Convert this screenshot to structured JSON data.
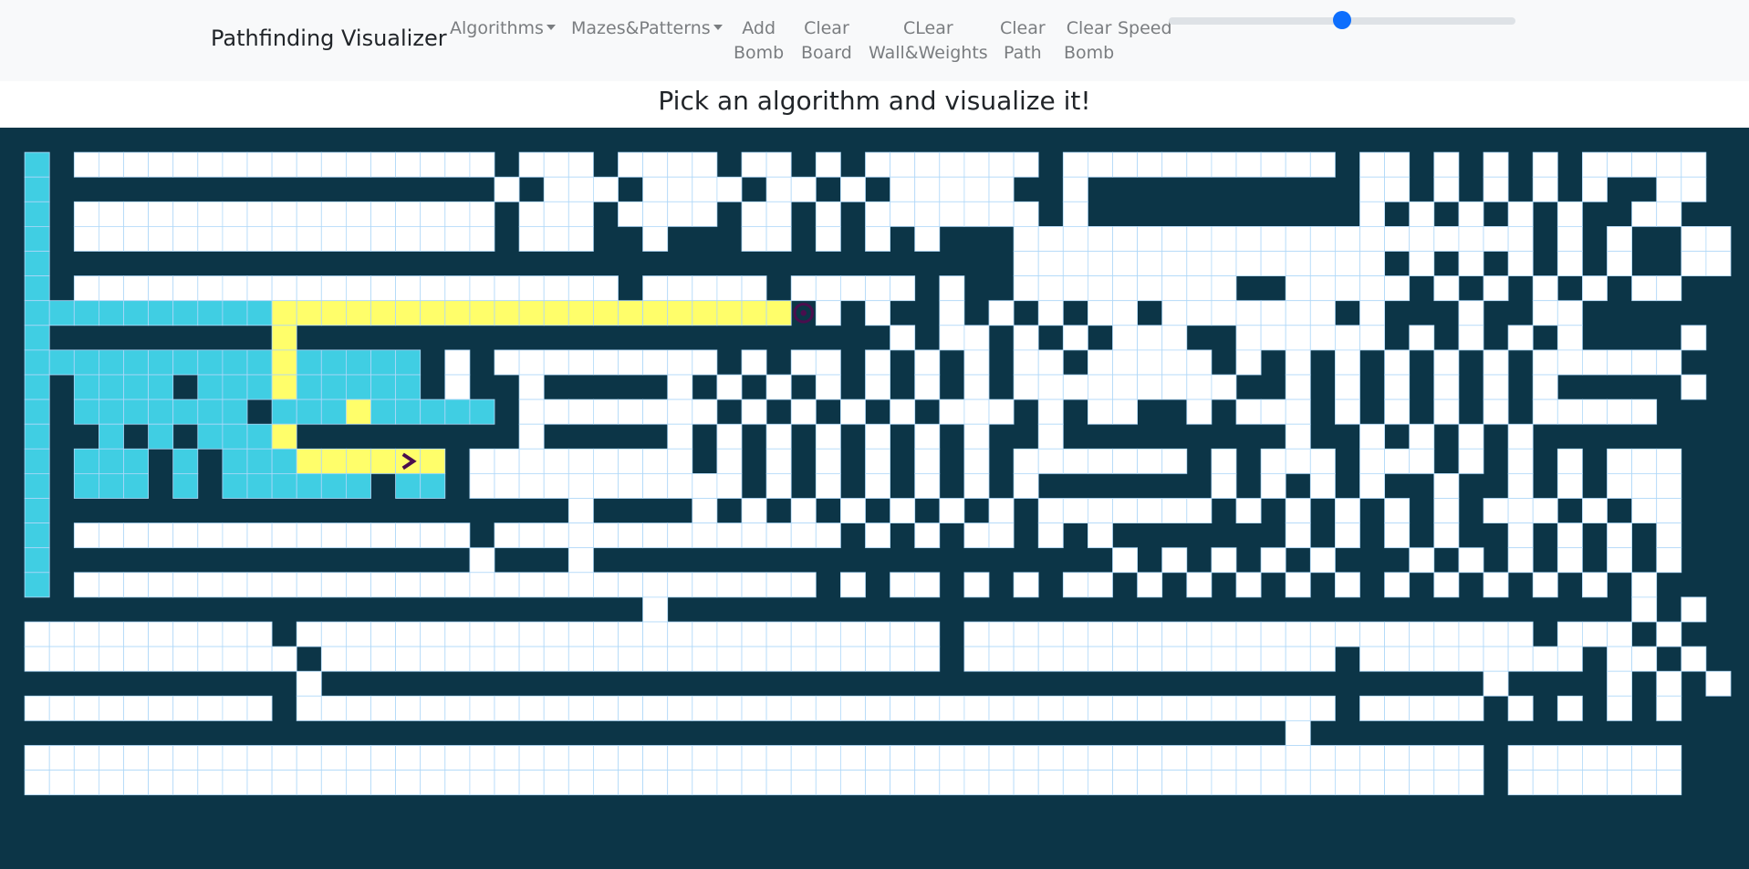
{
  "navbar": {
    "brand": "Pathfinding Visualizer",
    "algorithms": "Algorithms",
    "mazes": "Mazes&Patterns",
    "add_bomb": [
      "Add",
      "Bomb"
    ],
    "clear_board": [
      "Clear",
      "Board"
    ],
    "clear_walls": [
      "CLear",
      "Wall&Weights"
    ],
    "clear_path": [
      "Clear",
      "Path"
    ],
    "clear_bomb": [
      "Clear",
      "Bomb"
    ],
    "speed_label": "Speed",
    "speed_value": 0.5
  },
  "subtitle": "Pick an algorithm and visualize it!",
  "colors": {
    "wall": "#0c3547",
    "open": "#ffffff",
    "gridline": "#afd8f8",
    "visited": "#40cee3",
    "path": "#fffe6a",
    "marker": "#4a0e4e",
    "slider": "#0d6efd"
  },
  "icons": {
    "start": "chevron-right-icon",
    "target": "bullseye-icon"
  },
  "grid": {
    "rows": 28,
    "cols": 70,
    "start": [
      13,
      16
    ],
    "target": [
      7,
      32
    ],
    "cells": [
      "######################################################################",
      "#V#.................#...#....#..#.#.......#...........#..#.#.#.#.....#",
      "#V##################.#...#....#..#.#.....##.###########..#.#.#.#.##..#",
      "#V#.................#...#....#..#.#.......#.###########.#.#.#.#.##..#",
      "#V#.................#...##.###..#.#.#.###.....................#.#.##..#",
      "#V#######################################...............#.#.#.#.#.##..#",
      "#V#......................#.....#.....#.##.........##.....#.#.#.#.#..#",
      "#VVVVVVVVVVPPPPPPPPPPPPPPPPPPPPT#.#.##.#.#.#..#.......#.###.##..#",
      "#V#########P########################.#..#.#.#...##......#.#.#.#.####.#",
      "#VVVVVVVVVVPVVVVV#.#.........#.#..#.#.#.#..#.....#.#.#.#.#.#.#......#",
      "#V#VVVV#VVVPVVVVV#.##.#####.#.#.#.#.#.#.#.........##.#.#.#.#.#.#####.#",
      "#V#VVVVVVV#VVVPVVVVV#........#.#.#.#.#...#.#..##.#...#.#.#.#.#.....#",
      "#V##V#V#VVVP#########.#####.#.#.#.#.#.#.##.#########.##.#.#.#.#######",
      "#V#VVV#V#VVVPPPPPS#.........#.#.#.#.#.#.#.......#.#...#...#.#.#.#...#",
      "#V#VVV#V#VVVVVV#VV#...........#.#.#.#.#.#.#######.#.#.#.##.##.#.#...#",
      "#V#####################.####.#.#.#.#.#.#.#.......#.#.#.#.#.#...#.#..#",
      "#V#................#..............#.#.#..#.#.#######.#.#.#.##.#.#.#.#",
      "#V#################.###.#####################.#.#.#.#.###.#.#.#.#.#.#",
      "#V#..............................#.#..#.#.#..#.#.#.#.#.#.#.#.#.#.#.#",
      "##########################.#######################################.#.#.#.#.#",
      "#..........#..........................#.......................#...#.##.#.#.#",
      "#...........#.........................#...............#.........#..#.#.#.#.#",
      "############.###############################################.####.#.#.#.#.#",
      "#..........#..........................................#.....#.#.#.#.#",
      "####################################################.###############",
      "#...........................................................#.......#",
      "#...........................................................#.......#",
      "######################################################################"
    ]
  }
}
